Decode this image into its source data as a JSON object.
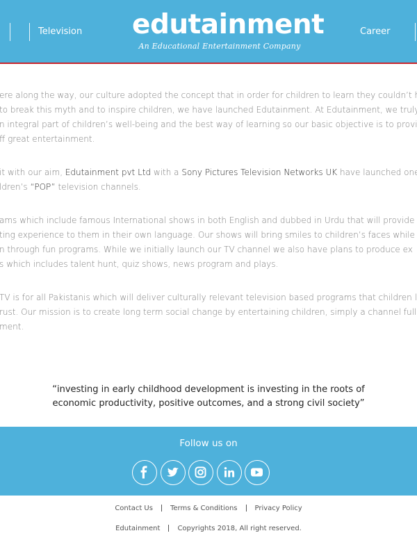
{
  "header": {
    "nav_left": "Television",
    "nav_right": "Career",
    "logo_text": "edutainment",
    "logo_tagline": "An Educational Entertainment Company"
  },
  "content": {
    "para1": [
      "ere along the way, our culture adopted the concept that in order for children to learn they couldn’t have an",
      "to break this myth and to inspire children, we have launched Edutainment. At Edutainment, we truly believe",
      "n integral part of children’s well-being and the best way of learning so our basic objective is to provide ch",
      "ff great entertainment."
    ],
    "para2": {
      "l1_a": "it with our aim, ",
      "l1_b": "Edutainment pvt Ltd",
      "l1_c": " with a ",
      "l1_d": "Sony Pictures Television Networks UK",
      "l1_e": " have launched one of",
      "l2_a": "ldren’s ",
      "l2_b": "“POP”",
      "l2_c": " television channels."
    },
    "para3": [
      "ams which include famous International shows in both English and dubbed in Urdu that will provide an am",
      "ting experience to them in their own language. Our shows will bring smiles to children’s faces while they ente",
      "n through fun programs. While we initially launch our TV channel we also have plans to produce ex",
      "s which includes talent hunt, quiz shows, news program and plays."
    ],
    "para4": [
      "TV is for all Pakistanis which will deliver culturally relevant television based programs that children love",
      "rust. Our  mission is to create  long term social  change by entertaining  children, simply  a  channel full  of",
      "ment."
    ]
  },
  "quote": {
    "line1": "“investing in early childhood development is investing in the roots of",
    "line2": "economic productivity, positive outcomes, and a strong civil society”"
  },
  "follow": {
    "title": "Follow us on",
    "icons": [
      "facebook-icon",
      "twitter-icon",
      "instagram-icon",
      "linkedin-icon",
      "youtube-icon"
    ]
  },
  "footer": {
    "links": [
      "Contact Us",
      "Terms & Conditions",
      "Privacy Policy"
    ],
    "brand": "Edutainment",
    "copyright": "Copyrights 2018, All right reserved."
  },
  "colors": {
    "brand_blue": "#4eb1db",
    "accent_red": "#c9262c",
    "body_text": "#7c7c7c"
  }
}
